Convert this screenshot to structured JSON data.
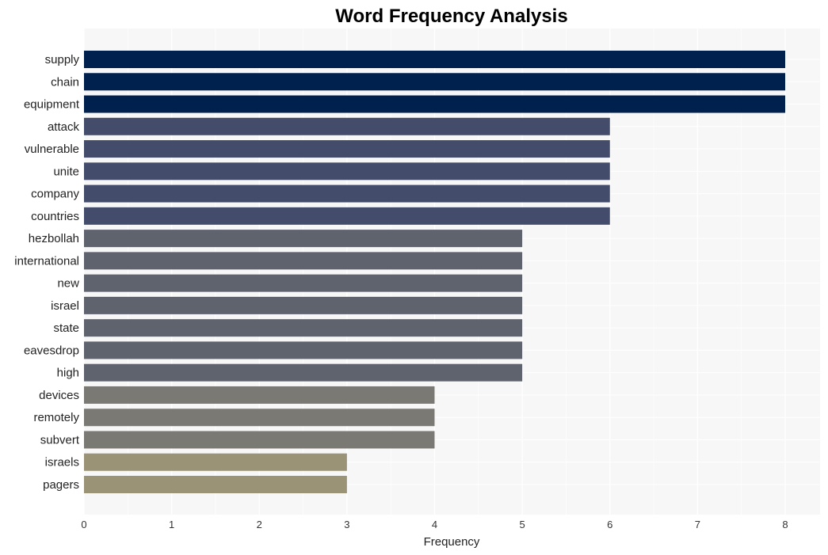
{
  "chart_data": {
    "type": "bar",
    "orientation": "horizontal",
    "title": "Word Frequency Analysis",
    "xlabel": "Frequency",
    "ylabel": "",
    "xlim": [
      0,
      8.4
    ],
    "xticks": [
      0,
      1,
      2,
      3,
      4,
      5,
      6,
      7,
      8
    ],
    "grid": true,
    "legend": "none",
    "categories": [
      "supply",
      "chain",
      "equipment",
      "attack",
      "vulnerable",
      "unite",
      "company",
      "countries",
      "hezbollah",
      "international",
      "new",
      "israel",
      "state",
      "eavesdrop",
      "high",
      "devices",
      "remotely",
      "subvert",
      "israels",
      "pagers"
    ],
    "values": [
      8,
      8,
      8,
      6,
      6,
      6,
      6,
      6,
      5,
      5,
      5,
      5,
      5,
      5,
      5,
      4,
      4,
      4,
      3,
      3
    ],
    "color_by_value": {
      "8": "#00214d",
      "6": "#434d6b",
      "5": "#5f636e",
      "4": "#7b7974",
      "3": "#9a9376"
    },
    "plot_background": "#f7f7f7",
    "grid_color": "#ffffff"
  }
}
